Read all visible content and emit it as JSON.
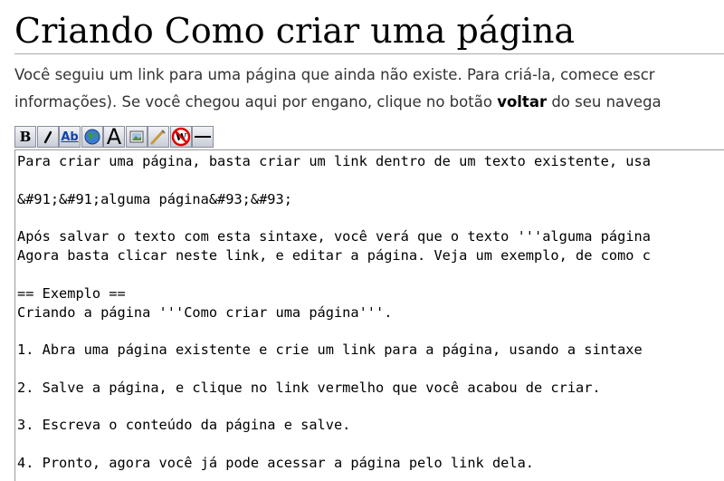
{
  "page": {
    "title": "Criando Como criar uma página",
    "intro_line1": "Você seguiu um link para uma página que ainda não existe. Para criá-la, comece escr",
    "intro_line2_pre": "informações). Se você chegou aqui por engano, clique no botão ",
    "intro_line2_bold": "voltar",
    "intro_line2_post": " do seu navega"
  },
  "toolbar": {
    "buttons": [
      {
        "name": "bold-button",
        "icon": "bold-icon",
        "label": "B"
      },
      {
        "name": "italic-button",
        "icon": "italic-icon",
        "label": "I"
      },
      {
        "name": "internal-link-button",
        "icon": "internal-link-icon",
        "label": "Ab"
      },
      {
        "name": "external-link-button",
        "icon": "globe-icon",
        "label": ""
      },
      {
        "name": "heading-button",
        "icon": "headline-icon",
        "label": "A"
      },
      {
        "name": "image-button",
        "icon": "image-icon",
        "label": ""
      },
      {
        "name": "math-button",
        "icon": "math-icon",
        "label": ""
      },
      {
        "name": "nowiki-button",
        "icon": "nowiki-icon",
        "label": ""
      },
      {
        "name": "horizontal-line-button",
        "icon": "horizontal-line-icon",
        "label": ""
      }
    ]
  },
  "editor": {
    "lines": [
      "Para criar uma página, basta criar um link dentro de um texto existente, usa",
      "&#91;&#91;alguma página&#93;&#93;",
      "Após salvar o texto com esta sintaxe, você verá que o texto '''alguma página",
      "Agora basta clicar neste link, e editar a página. Veja um exemplo, de como c",
      "== Exemplo ==",
      "Criando a página '''Como criar uma página'''.",
      "1. Abra uma página existente e crie um link para a página, usando a sintaxe",
      "2. Salve a página, e clique no link vermelho que você acabou de criar.",
      "3. Escreva o conteúdo da página e salve.",
      "4. Pronto, agora você já pode acessar a página pelo link dela."
    ]
  }
}
